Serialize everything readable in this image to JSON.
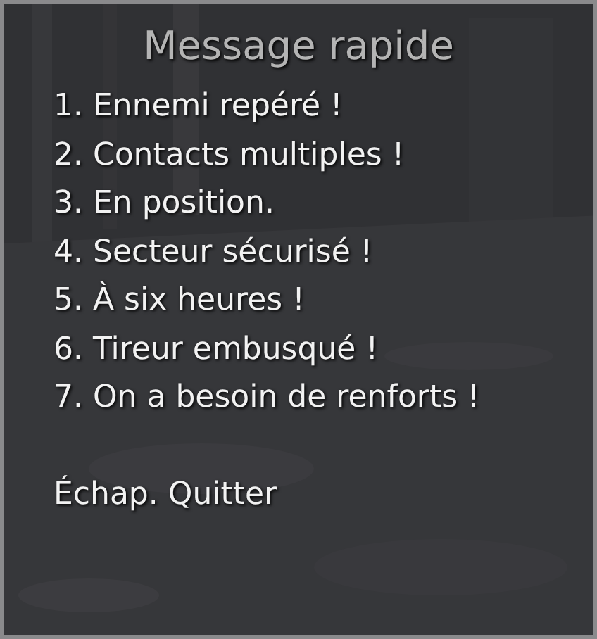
{
  "menu": {
    "title": "Message rapide",
    "items": [
      "1. Ennemi repéré !",
      "2. Contacts multiples !",
      "3. En position.",
      "4. Secteur sécurisé !",
      "5. À six heures !",
      "6. Tireur embusqué !",
      "7. On a besoin de renforts !"
    ],
    "exit": "Échap. Quitter"
  }
}
